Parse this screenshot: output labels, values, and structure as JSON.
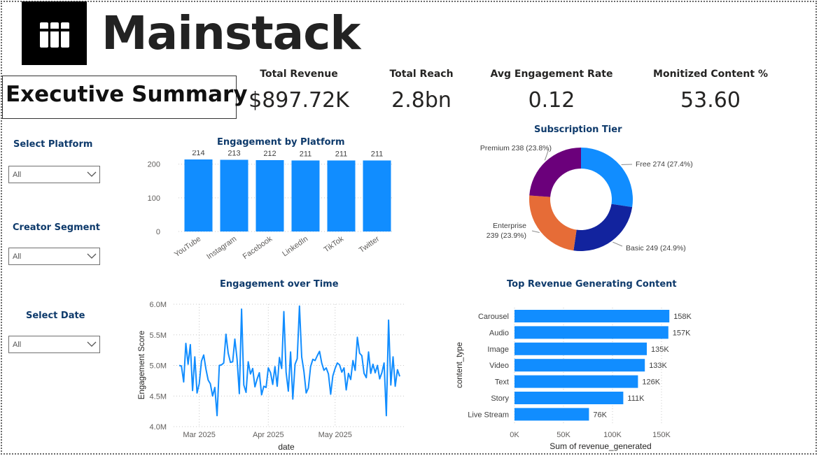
{
  "brand": {
    "name": "Mainstack",
    "logo_icon": "mainstack-logo-icon"
  },
  "page_title": "Executive Summary",
  "kpis": [
    {
      "label": "Total Revenue",
      "value": "$897.72K"
    },
    {
      "label": "Total Reach",
      "value": "2.8bn"
    },
    {
      "label": "Avg Engagement Rate",
      "value": "0.12"
    },
    {
      "label": "Monitized Content %",
      "value": "53.60"
    }
  ],
  "slicers": [
    {
      "title": "Select Platform",
      "value": "All"
    },
    {
      "title": "Creator Segment",
      "value": "All"
    },
    {
      "title": "Select Date",
      "value": "All"
    }
  ],
  "colors": {
    "bar": "#118dff",
    "line": "#118dff",
    "title": "#0e3a6b",
    "free": "#118dff",
    "basic": "#12239e",
    "enterprise": "#e66c37",
    "premium": "#6b007b"
  },
  "chart_data": [
    {
      "id": "engagement_by_platform",
      "type": "bar",
      "title": "Engagement by Platform",
      "categories": [
        "YouTube",
        "Instagram",
        "Facebook",
        "LinkedIn",
        "TikTok",
        "Twitter"
      ],
      "values": [
        214,
        213,
        212,
        211,
        211,
        211
      ],
      "data_labels": [
        "214",
        "213",
        "212",
        "211",
        "211",
        "211"
      ],
      "y_ticks": [
        0,
        100,
        200
      ],
      "ylim": [
        0,
        214
      ],
      "grid": true
    },
    {
      "id": "subscription_tier",
      "type": "pie",
      "title": "Subscription Tier",
      "donut": true,
      "slices": [
        {
          "label": "Free",
          "value": 274,
          "text": "Free 274 (27.4%)",
          "color": "#118dff"
        },
        {
          "label": "Basic",
          "value": 249,
          "text": "Basic 249 (24.9%)",
          "color": "#12239e"
        },
        {
          "label": "Enterprise",
          "value": 239,
          "text_lines": [
            "Enterprise",
            "239 (23.9%)"
          ],
          "color": "#e66c37"
        },
        {
          "label": "Premium",
          "value": 238,
          "text": "Premium 238 (23.8%)",
          "color": "#6b007b"
        }
      ]
    },
    {
      "id": "engagement_over_time",
      "type": "line",
      "title": "Engagement over Time",
      "xlabel": "date",
      "ylabel": "Engagement Score",
      "x_ticks": [
        "Mar 2025",
        "Apr 2025",
        "May 2025"
      ],
      "y_ticks": [
        "4.0M",
        "4.5M",
        "5.0M",
        "5.5M",
        "6.0M"
      ],
      "ylim": [
        4.0,
        6.0
      ],
      "grid": true,
      "x_start": "2025-02-20",
      "x_tick_dates": [
        "2025-03-01",
        "2025-04-01",
        "2025-05-01"
      ],
      "values_millions": [
        5.0,
        4.99,
        4.73,
        5.36,
        5.02,
        5.34,
        4.59,
        5.14,
        4.55,
        4.7,
        5.07,
        5.17,
        4.94,
        4.76,
        4.7,
        4.5,
        4.64,
        4.18,
        5.0,
        5.01,
        5.04,
        5.51,
        5.2,
        5.05,
        5.06,
        5.43,
        5.1,
        4.54,
        5.92,
        4.68,
        4.56,
        5.06,
        4.86,
        4.95,
        4.65,
        4.78,
        4.88,
        4.52,
        4.66,
        4.64,
        4.96,
        4.88,
        4.69,
        4.98,
        4.66,
        5.13,
        4.95,
        5.88,
        4.89,
        4.58,
        5.22,
        4.45,
        5.02,
        5.11,
        5.97,
        5.14,
        4.9,
        4.55,
        4.63,
        4.98,
        5.1,
        5.08,
        5.16,
        5.23,
        5.04,
        4.92,
        4.96,
        4.86,
        4.53,
        4.83,
        4.95,
        5.04,
        5.01,
        4.89,
        4.96,
        4.6,
        4.87,
        4.77,
        5.08,
        4.92,
        5.46,
        5.2,
        5.16,
        4.87,
        4.8,
        5.22,
        4.87,
        5.02,
        4.88,
        5.0,
        4.78,
        4.88,
        5.04,
        4.18,
        5.74,
        4.68,
        5.14,
        4.66,
        4.93,
        4.82
      ]
    },
    {
      "id": "top_revenue_content",
      "type": "bar",
      "orientation": "horizontal",
      "title": "Top Revenue Generating Content",
      "xlabel": "Sum of revenue_generated",
      "ylabel": "content_type",
      "categories": [
        "Carousel",
        "Audio",
        "Image",
        "Video",
        "Text",
        "Story",
        "Live Stream"
      ],
      "values": [
        158000,
        157000,
        135000,
        133000,
        126000,
        111000,
        76000
      ],
      "data_labels": [
        "158K",
        "157K",
        "135K",
        "133K",
        "126K",
        "111K",
        "76K"
      ],
      "x_ticks": [
        "0K",
        "50K",
        "100K",
        "150K"
      ],
      "xlim": [
        0,
        165000
      ],
      "grid": true
    }
  ]
}
